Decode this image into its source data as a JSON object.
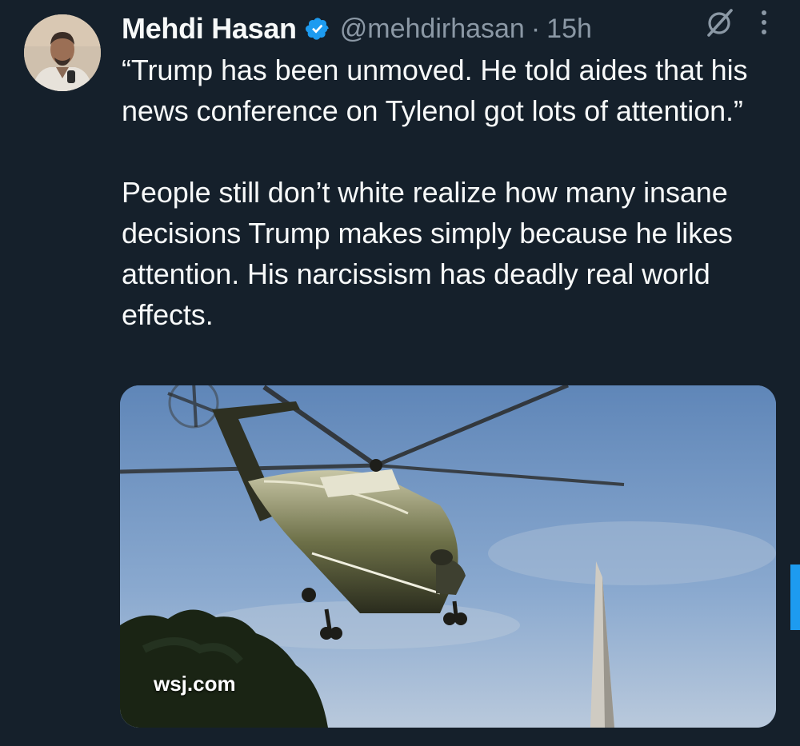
{
  "author": {
    "display_name": "Mehdi Hasan",
    "handle": "@mehdirhasan",
    "separator": "·",
    "time": "15h"
  },
  "tweet": {
    "paragraph1": "“Trump has been unmoved. He told aides that his news conference on Tylenol got lots of attention.”",
    "paragraph2": "People still don’t white realize how many insane decisions Trump makes simply because he likes attention. His narcissism has deadly real world effects."
  },
  "card": {
    "domain": "wsj.com",
    "image_alt": "Marine One helicopter in flight near the Washington Monument"
  },
  "colors": {
    "background": "#15202b",
    "text": "#f7f9f9",
    "secondary": "#8b98a5",
    "accent": "#1d9bf0"
  },
  "icons": {
    "verified": "verified-badge-icon",
    "grok": "grok-icon",
    "more": "more-options-icon"
  }
}
